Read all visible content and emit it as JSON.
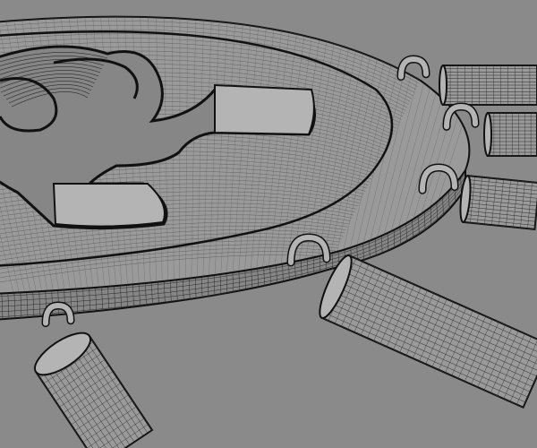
{
  "scene": {
    "background_color": "#8a8a8a",
    "surface_color": "#9a9a9a",
    "surface_dark": "#868686",
    "wire_color": "#2a2a2a",
    "wire_light": "#4d4d4d",
    "outline_color": "#111111",
    "highlight_color": "#b4b4b4"
  }
}
